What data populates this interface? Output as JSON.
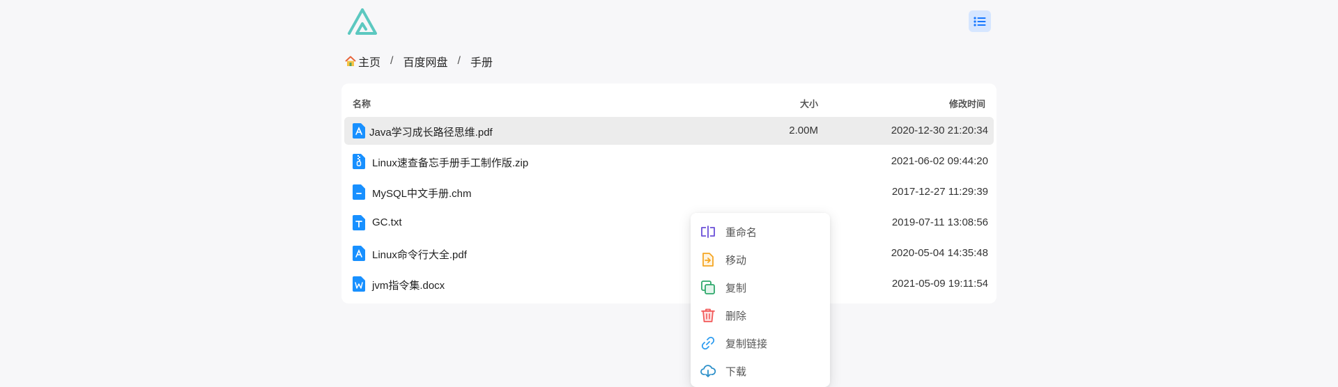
{
  "breadcrumb": {
    "home": "主页",
    "sep1": "/",
    "level1": "百度网盘",
    "sep2": "/",
    "level2": "手册"
  },
  "table": {
    "headers": {
      "name": "名称",
      "size": "大小",
      "modified": "修改时间"
    },
    "rows": [
      {
        "name": "Java学习成长路径思维.pdf",
        "size": "2.00M",
        "modified": "2020-12-30 21:20:34",
        "icon": "pdf-file-icon"
      },
      {
        "name": "Linux速查备忘手册手工制作版.zip",
        "size": "",
        "modified": "2021-06-02 09:44:20",
        "icon": "zip-file-icon"
      },
      {
        "name": "MySQL中文手册.chm",
        "size": "",
        "modified": "2017-12-27 11:29:39",
        "icon": "chm-file-icon"
      },
      {
        "name": "GC.txt",
        "size": "",
        "modified": "2019-07-11 13:08:56",
        "icon": "txt-file-icon"
      },
      {
        "name": "Linux命令行大全.pdf",
        "size": "",
        "modified": "2020-05-04 14:35:48",
        "icon": "pdf-file-icon"
      },
      {
        "name": "jvm指令集.docx",
        "size": "",
        "modified": "2021-05-09 19:11:54",
        "icon": "docx-file-icon"
      }
    ]
  },
  "context_menu": {
    "items": [
      {
        "label": "重命名",
        "icon": "rename-icon"
      },
      {
        "label": "移动",
        "icon": "move-icon"
      },
      {
        "label": "复制",
        "icon": "copy-icon"
      },
      {
        "label": "删除",
        "icon": "delete-icon"
      },
      {
        "label": "复制链接",
        "icon": "link-icon"
      },
      {
        "label": "下载",
        "icon": "download-icon"
      }
    ]
  },
  "colors": {
    "accent": "#1890ff",
    "logo": "#5cc8c0",
    "menu_button_bg": "#d6e6ff",
    "rename": "#6a4fd8",
    "move": "#f5a623",
    "copy": "#2ea86b",
    "delete": "#f25a5a",
    "link": "#2d9cf0",
    "download": "#2b8fc9"
  }
}
